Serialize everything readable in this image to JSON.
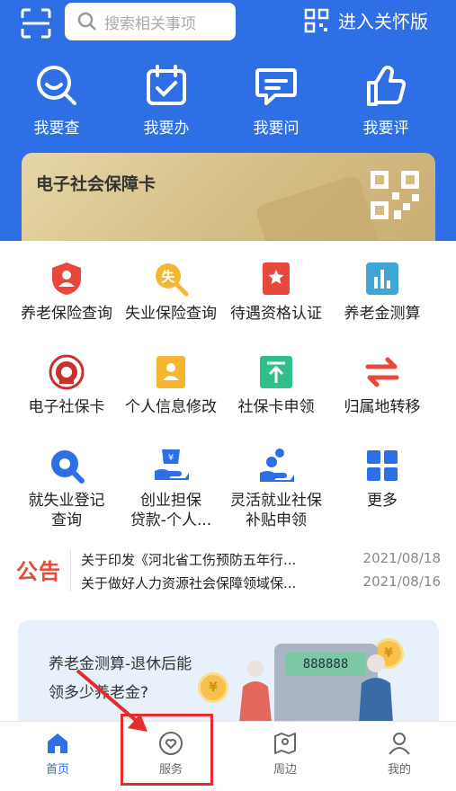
{
  "header": {
    "search_placeholder": "搜索相关事项",
    "care_mode_label": "进入关怀版"
  },
  "quick_actions": [
    {
      "label": "我要查",
      "icon": "search-smile-icon"
    },
    {
      "label": "我要办",
      "icon": "calendar-check-icon"
    },
    {
      "label": "我要问",
      "icon": "chat-bubble-icon"
    },
    {
      "label": "我要评",
      "icon": "thumbs-up-icon"
    }
  ],
  "card": {
    "title": "电子社会保障卡",
    "icon": "qr-code-icon"
  },
  "services": [
    {
      "label": "养老保险查询",
      "icon": "shield-person-icon",
      "color": "#e8473c"
    },
    {
      "label": "失业保险查询",
      "icon": "magnifier-shi-icon",
      "color": "#f5b731"
    },
    {
      "label": "待遇资格认证",
      "icon": "bookmark-star-icon",
      "color": "#e8473c"
    },
    {
      "label": "养老金测算",
      "icon": "bar-chart-icon",
      "color": "#3ea7d6"
    },
    {
      "label": "电子社保卡",
      "icon": "emblem-icon",
      "color": "#c9302c"
    },
    {
      "label": "个人信息修改",
      "icon": "id-card-icon",
      "color": "#f5b731"
    },
    {
      "label": "社保卡申领",
      "icon": "upload-icon",
      "color": "#2fbf8a"
    },
    {
      "label": "归属地转移",
      "icon": "transfer-arrows-icon",
      "color": "#e8473c"
    },
    {
      "label": "就失业登记查询",
      "label_line1": "就失业登记",
      "label_line2": "查询",
      "icon": "search-circle-icon",
      "color": "#2f6fe6"
    },
    {
      "label": "创业担保贷款-个人...",
      "label_line1": "创业担保",
      "label_line2": "贷款-个人...",
      "icon": "hand-yen-icon",
      "color": "#2f6fe6"
    },
    {
      "label": "灵活就业社保补贴申领",
      "label_line1": "灵活就业社保",
      "label_line2": "补贴申领",
      "icon": "hand-person-icon",
      "color": "#2f6fe6"
    },
    {
      "label": "更多",
      "icon": "grid-icon",
      "color": "#2f6fe6"
    }
  ],
  "notice": {
    "logo_text": "公告",
    "items": [
      {
        "title": "关于印发《河北省工伤预防五年行...",
        "date": "2021/08/18"
      },
      {
        "title": "关于做好人力资源社会保障领域保...",
        "date": "2021/08/16"
      }
    ]
  },
  "banner": {
    "line1": "养老金测算-退休后能",
    "line2": "领多少养老金?",
    "calc_display": "888888",
    "coin_symbol": "¥"
  },
  "tabbar": [
    {
      "label": "首页",
      "icon": "home-icon",
      "active": true
    },
    {
      "label": "服务",
      "icon": "heart-circle-icon",
      "active": false
    },
    {
      "label": "周边",
      "icon": "map-icon",
      "active": false
    },
    {
      "label": "我的",
      "icon": "user-icon",
      "active": false
    }
  ],
  "colors": {
    "primary": "#2f6fe6",
    "annotation": "#e52b2b"
  }
}
